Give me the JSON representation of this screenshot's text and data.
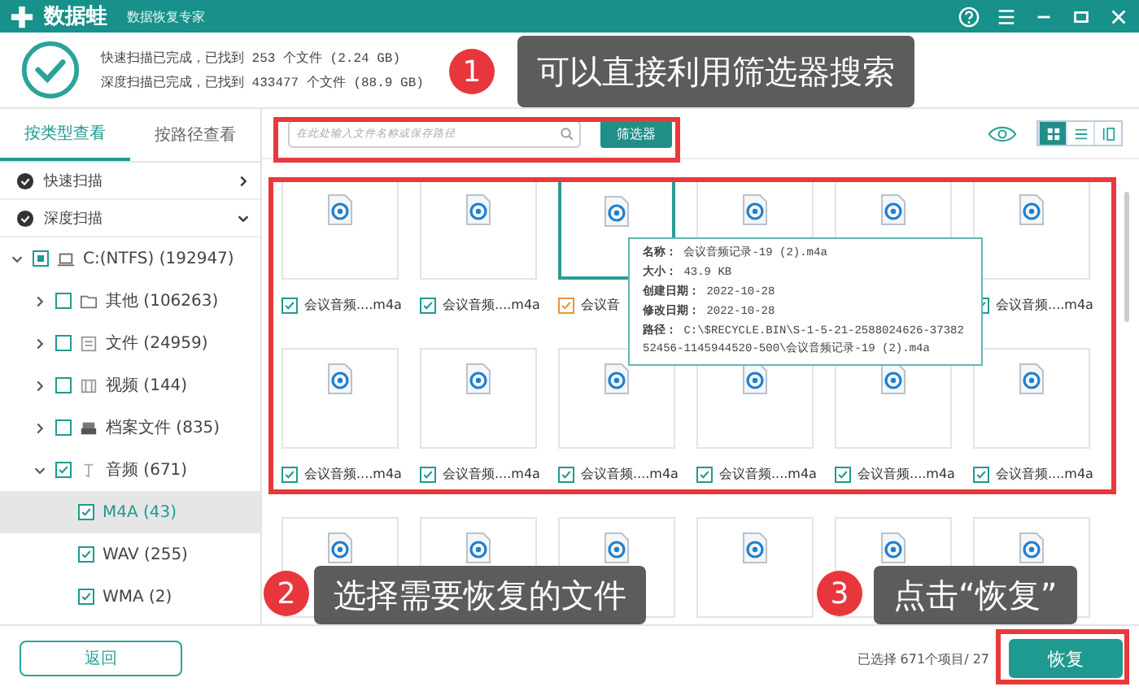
{
  "titlebar": {
    "app_name": "数据蛙",
    "subtitle": "数据恢复专家"
  },
  "scan_summary": [
    "快速扫描已完成，已找到 253 个文件 (2.24 GB)",
    "深度扫描已完成，已找到 433477 个文件 (88.9 GB)"
  ],
  "sidebar": {
    "tabs": [
      {
        "label": "按类型查看",
        "selected": true
      },
      {
        "label": "按路径查看",
        "selected": false
      }
    ],
    "scan_groups": [
      {
        "label": "快速扫描",
        "expanded": false
      },
      {
        "label": "深度扫描",
        "expanded": true
      }
    ],
    "tree": [
      {
        "label": "C:(NTFS) (192947)",
        "kind": "drive",
        "partial": true,
        "expanded": true,
        "selected": false,
        "children": [
          {
            "label": "其他 (106263)",
            "kind": "folder",
            "checked": false,
            "expanded": false,
            "selected": false
          },
          {
            "label": "文件 (24959)",
            "kind": "document",
            "checked": false,
            "expanded": false,
            "selected": false
          },
          {
            "label": "视频 (144)",
            "kind": "video",
            "checked": false,
            "expanded": false,
            "selected": false
          },
          {
            "label": "档案文件 (835)",
            "kind": "archive",
            "checked": false,
            "expanded": false,
            "selected": false
          },
          {
            "label": "音频 (671)",
            "kind": "audio",
            "checked": true,
            "expanded": true,
            "selected": false,
            "children": [
              {
                "label": "M4A (43)",
                "checked": true,
                "selected": true
              },
              {
                "label": "WAV (255)",
                "checked": true,
                "selected": false
              },
              {
                "label": "WMA (2)",
                "checked": true,
                "selected": false
              }
            ]
          }
        ]
      }
    ]
  },
  "toolbar": {
    "search": {
      "placeholder": "在此处输入文件名称或保存路径"
    },
    "filter_button": "筛选器",
    "view_modes": [
      {
        "kind": "grid",
        "selected": true
      },
      {
        "kind": "list",
        "selected": false
      },
      {
        "kind": "detail",
        "selected": false
      }
    ]
  },
  "grid": [
    [
      {
        "label": "会议音频....m4a",
        "checked": true,
        "hovered": false
      },
      {
        "label": "会议音频....m4a",
        "checked": true,
        "hovered": false
      },
      {
        "label": "会议音",
        "checked": true,
        "hovered": true
      },
      {
        "hovered": false
      },
      {
        "hovered": false
      },
      {
        "label": "会议音频....m4a",
        "checked": true,
        "hovered": false
      }
    ],
    [
      {
        "label": "会议音频....m4a",
        "checked": true,
        "hovered": false
      },
      {
        "label": "会议音频....m4a",
        "checked": true,
        "hovered": false
      },
      {
        "label": "会议音频....m4a",
        "checked": true,
        "hovered": false
      },
      {
        "label": "会议音频....m4a",
        "checked": true,
        "hovered": false
      },
      {
        "label": "会议音频....m4a",
        "checked": true,
        "hovered": false
      },
      {
        "label": "会议音频....m4a",
        "checked": true,
        "hovered": false
      }
    ],
    [
      {
        "hovered": false
      },
      {
        "hovered": false
      },
      {
        "hovered": false
      },
      {
        "hovered": false
      },
      {
        "hovered": false
      },
      {
        "hovered": false
      }
    ]
  ],
  "file_tooltip": [
    {
      "label": "名称：",
      "value": "会议音频记录-19 (2).m4a"
    },
    {
      "label": "大小：",
      "value": "43.9 KB"
    },
    {
      "label": "创建日期：",
      "value": "2022-10-28"
    },
    {
      "label": "修改日期：",
      "value": "2022-10-28"
    },
    {
      "label": "路径：",
      "value": "C:\\$RECYCLE.BIN\\S-1-5-21-2588024626-3738252456-1145944520-500\\会议音频记录-19 (2).m4a"
    }
  ],
  "footer": {
    "back_button": "返回",
    "status": "已选择 671个项目/ 27",
    "recover_button": "恢复"
  },
  "annotations": [
    {
      "number": "1",
      "text": "可以直接利用筛选器搜索"
    },
    {
      "number": "2",
      "text": "选择需要恢复的文件"
    },
    {
      "number": "3",
      "text": "点击“恢复”"
    }
  ]
}
